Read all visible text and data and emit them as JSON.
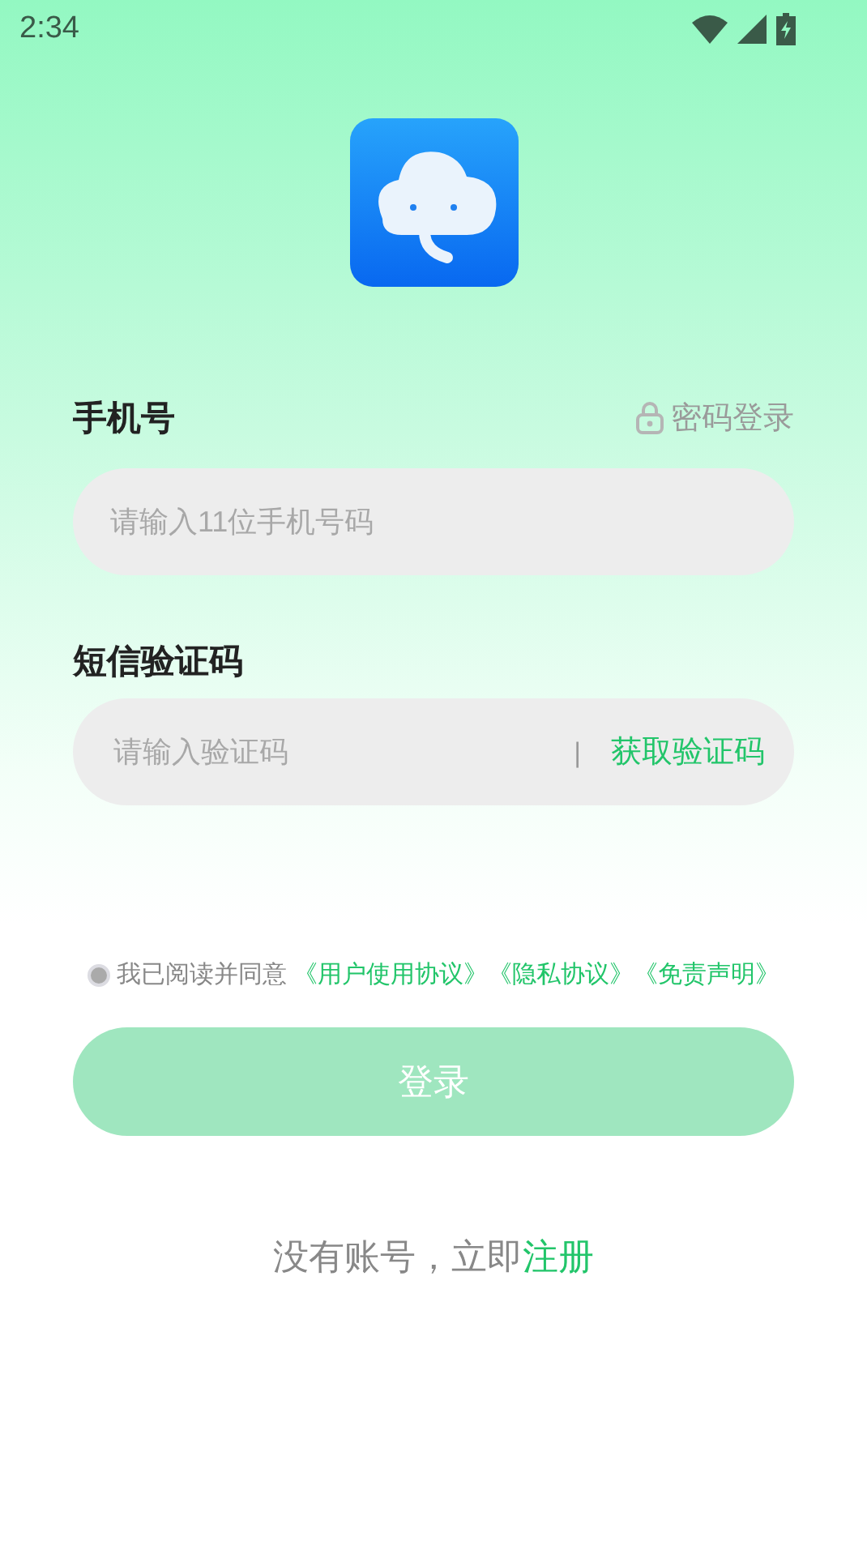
{
  "status_bar": {
    "time": "2:34"
  },
  "phone": {
    "label": "手机号",
    "switch_link": "密码登录",
    "placeholder": "请输入11位手机号码"
  },
  "code": {
    "label": "短信验证码",
    "placeholder": "请输入验证码",
    "divider": "|",
    "action": "获取验证码"
  },
  "agreement": {
    "checked": false,
    "text": "我已阅读并同意",
    "links": [
      "《用户使用协议》",
      "《隐私协议》",
      "《免责声明》"
    ]
  },
  "login_button": {
    "label": "登录",
    "disabled": true
  },
  "register": {
    "text": "没有账号，立即",
    "link": "注册"
  }
}
